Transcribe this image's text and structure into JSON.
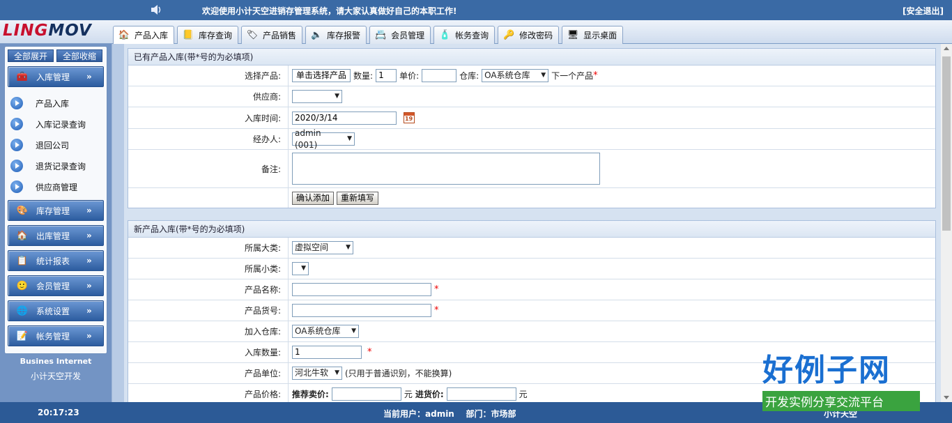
{
  "topbar": {
    "welcome": "欢迎使用小计天空进销存管理系统，请大家认真做好自己的本职工作!",
    "logout": "[安全退出]"
  },
  "logo": {
    "part1": "LING",
    "part2": "MOV"
  },
  "tabs": [
    {
      "label": "产品入库",
      "icon": "house-icon"
    },
    {
      "label": "库存查询",
      "icon": "book-icon"
    },
    {
      "label": "产品销售",
      "icon": "tag-icon"
    },
    {
      "label": "库存报警",
      "icon": "speaker-icon"
    },
    {
      "label": "会员管理",
      "icon": "member-card-icon"
    },
    {
      "label": "帐务查询",
      "icon": "bottle-icon"
    },
    {
      "label": "修改密码",
      "icon": "key-icon"
    },
    {
      "label": "显示桌面",
      "icon": "desktop-icon"
    }
  ],
  "sidebar": {
    "expand_all": "全部展开",
    "collapse_all": "全部收缩",
    "menus": [
      {
        "label": "入库管理",
        "icon": "inbound-icon"
      },
      {
        "label": "库存管理",
        "icon": "stock-icon"
      },
      {
        "label": "出库管理",
        "icon": "outbound-icon"
      },
      {
        "label": "统计报表",
        "icon": "report-icon"
      },
      {
        "label": "会员管理",
        "icon": "member-icon"
      },
      {
        "label": "系统设置",
        "icon": "globe-icon"
      },
      {
        "label": "帐务管理",
        "icon": "account-icon"
      }
    ],
    "subitems": [
      "产品入库",
      "入库记录查询",
      "退回公司",
      "退货记录查询",
      "供应商管理"
    ],
    "chevron": "»",
    "brand_en": "Busines Internet",
    "brand_cn": "小计天空开发"
  },
  "existing": {
    "title": "已有产品入库(带*号的为必填项)",
    "select_product_label": "选择产品:",
    "select_product_button": "单击选择产品",
    "qty_label": "数量:",
    "qty_value": "1",
    "price_label": "单价:",
    "price_value": "",
    "warehouse_label": "仓库:",
    "warehouse_value": "OA系统仓库",
    "next_product": "下一个产品",
    "supplier_label": "供应商:",
    "supplier_value": "",
    "date_label": "入库时间:",
    "date_value": "2020/3/14",
    "calendar_day": "19",
    "handler_label": "经办人:",
    "handler_value": "admin (001)",
    "remark_label": "备注:",
    "confirm_button": "确认添加",
    "reset_button": "重新填写"
  },
  "newproduct": {
    "title": "新产品入库(带*号的为必填项)",
    "category_label": "所属大类:",
    "category_value": "虚拟空间",
    "subcategory_label": "所属小类:",
    "subcategory_value": "",
    "name_label": "产品名称:",
    "name_value": "",
    "code_label": "产品货号:",
    "code_value": "",
    "warehouse_label": "加入仓库:",
    "warehouse_value": "OA系统仓库",
    "qty_label": "入库数量:",
    "qty_value": "1",
    "unit_label": "产品单位:",
    "unit_value": "河北牛软",
    "unit_note": "(只用于普通识别，不能换算)",
    "price_label": "产品价格:",
    "sell_label": "推荐卖价:",
    "yuan": "元",
    "buy_label": "进货价:"
  },
  "required_mark": "*",
  "bottombar": {
    "time": "20:17:23",
    "user": "当前用户：admin    部门：市场部",
    "right": "小计天空"
  },
  "watermark": {
    "big": "好例子网",
    "small": "开发实例分享交流平台"
  }
}
